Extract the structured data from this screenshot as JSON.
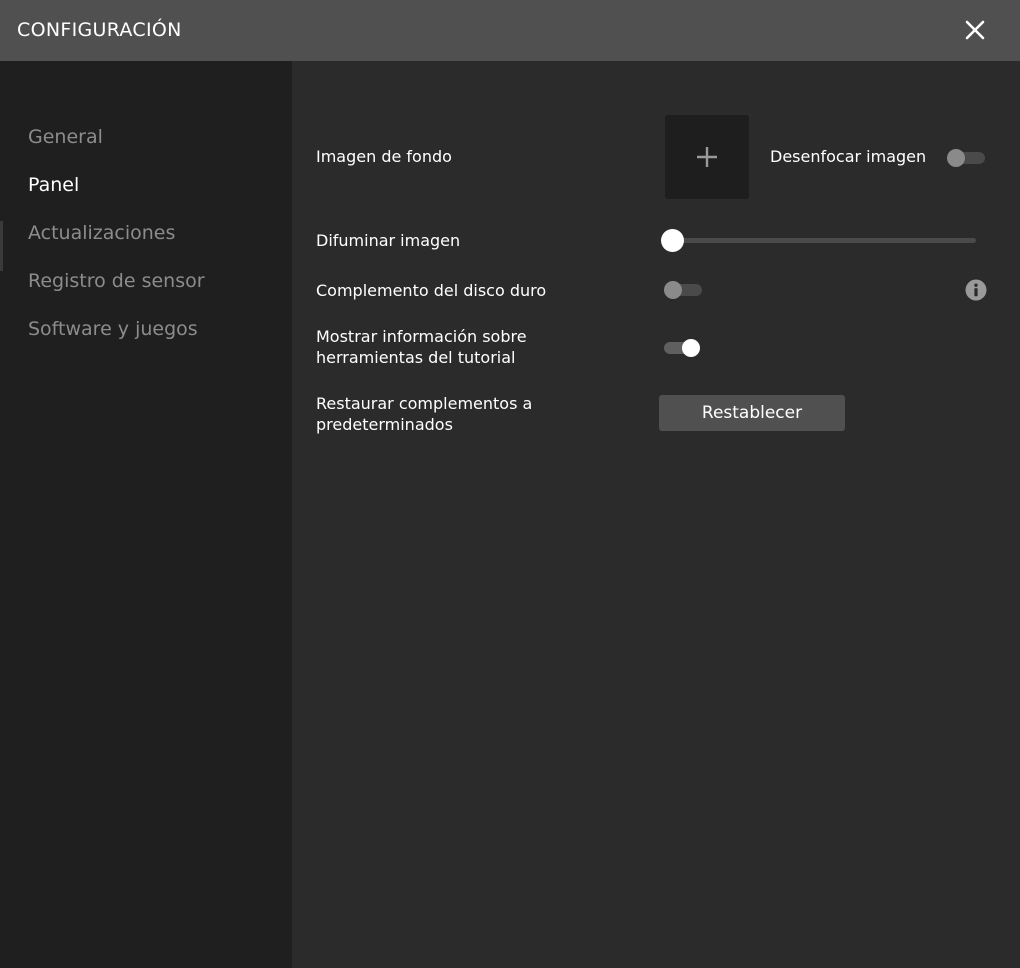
{
  "window": {
    "title": "CONFIGURACIÓN",
    "close_icon": "close-icon"
  },
  "sidebar": {
    "items": [
      {
        "label": "General",
        "active": false
      },
      {
        "label": "Panel",
        "active": true
      },
      {
        "label": "Actualizaciones",
        "active": false
      },
      {
        "label": "Registro de sensor",
        "active": false
      },
      {
        "label": "Software y juegos",
        "active": false
      }
    ]
  },
  "settings": {
    "background_image": {
      "label": "Imagen de fondo",
      "add_icon": "plus-icon",
      "blur_label": "Desenfocar imagen",
      "blur_enabled": false
    },
    "fade_image": {
      "label": "Difuminar imagen",
      "value": 0
    },
    "hdd_plugin": {
      "label": "Complemento del disco duro",
      "enabled": false,
      "info_icon": "info-icon"
    },
    "tutorial_info": {
      "label_line1": "Mostrar información sobre",
      "label_line2": "herramientas del tutorial",
      "enabled": true
    },
    "restore_plugins": {
      "label_line1": "Restaurar complementos a",
      "label_line2": "predeterminados",
      "button_label": "Restablecer"
    }
  },
  "colors": {
    "background": "#2b2b2b",
    "sidebar": "#1f1f1f",
    "titlebar": "#505050",
    "inactive_text": "#8c8c8c",
    "active_text": "#ffffff"
  }
}
